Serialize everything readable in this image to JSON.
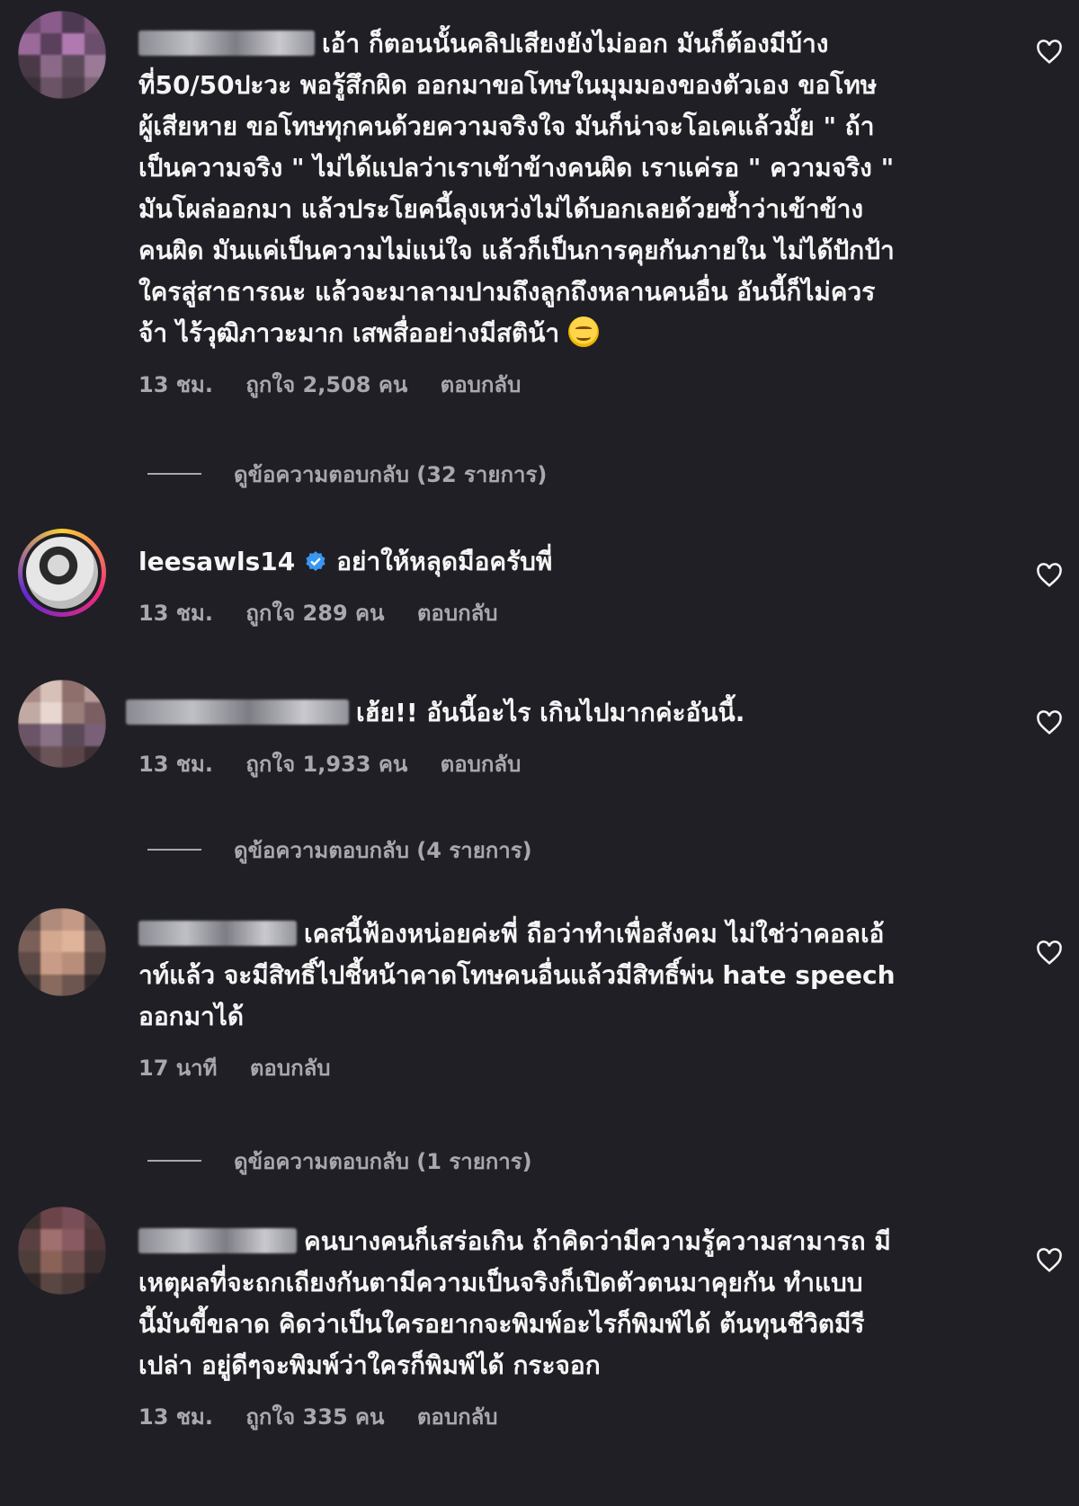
{
  "comments": [
    {
      "username": "",
      "verified": false,
      "text_lines": [
        "เอ้า ก็ตอนนั้นคลิปเสียงยังไม่ออก มันก็ต้องมีบ้าง",
        "ที่50/50ปะวะ พอรู้สึกผิด ออกมาขอโทษในมุมมองของตัวเอง ขอโทษ",
        "ผู้เสียหาย ขอโทษทุกคนด้วยความจริงใจ มันก็น่าจะโอเคแล้วมั้ย \" ถ้า",
        "เป็นความจริง \" ไม่ได้แปลว่าเราเข้าข้างคนผิด เราแค่รอ \" ความจริง \"",
        "มันโผล่ออกมา แล้วประโยคนี้ลุงเหว่งไม่ได้บอกเลยด้วยซ้ำว่าเข้าข้าง",
        "คนผิด มันแค่เป็นความไม่แน่ใจ แล้วก็เป็นการคุยกันภายใน ไม่ได้ปักป้า",
        "ใครสู่สาธารณะ แล้วจะมาลามปามถึงลูกถึงหลานคนอื่น อันนี้ก็ไม่ควร",
        "จ้า ไร้วุฒิภาวะมาก เสพสื่ออย่างมีสติน้า"
      ],
      "emoji": "smiling-face",
      "time": "13 ชม.",
      "likes": "ถูกใจ 2,508 คน",
      "reply_label": "ตอบกลับ",
      "view_replies": "ดูข้อความตอบกลับ (32 รายการ)"
    },
    {
      "username": "leesawls14",
      "verified": true,
      "text_lines": [
        "อย่าให้หลุดมือครับพี่"
      ],
      "time": "13 ชม.",
      "likes": "ถูกใจ 289 คน",
      "reply_label": "ตอบกลับ"
    },
    {
      "username": "",
      "verified": false,
      "text_lines": [
        "เฮ้ย!! อันนี้อะไร เกินไปมากค่ะอันนี้."
      ],
      "time": "13 ชม.",
      "likes": "ถูกใจ 1,933 คน",
      "reply_label": "ตอบกลับ",
      "view_replies": "ดูข้อความตอบกลับ (4 รายการ)"
    },
    {
      "username": "",
      "verified": false,
      "text_lines": [
        "เคสนี้ฟ้องหน่อยค่ะพี่ ถือว่าทำเพื่อสังคม ไม่ใช่ว่าคอลเอ้",
        "าท์แล้ว จะมีสิทธิ์ไปชี้หน้าคาดโทษคนอื่นแล้วมีสิทธิ์พ่น hate speech",
        "ออกมาได้"
      ],
      "time": "17 นาที",
      "reply_label": "ตอบกลับ",
      "view_replies": "ดูข้อความตอบกลับ (1 รายการ)"
    },
    {
      "username": "",
      "verified": false,
      "text_lines": [
        "คนบางคนก็เสร่อเกิน ถ้าคิดว่ามีความรู้ความสามารถ มี",
        "เหตุผลที่จะถกเถียงกันตามีความเป็นจริงก็เปิดตัวตนมาคุยกัน ทำแบบ",
        "นี้มันขี้ขลาด คิดว่าเป็นใครอยากจะพิมพ์อะไรก็พิมพ์ได้ ต้นทุนชีวิตมีรี",
        "เปล่า อยู่ดีๆจะพิมพ์ว่าใครก็พิมพ์ได้ กระจอก"
      ],
      "time": "13 ชม.",
      "likes": "ถูกใจ 335 คน",
      "reply_label": "ตอบกลับ"
    }
  ],
  "colors": {
    "background": "#1f1f25",
    "text": "#f5f5f5",
    "muted": "#a8a8ad",
    "verified_blue": "#3897f0"
  }
}
